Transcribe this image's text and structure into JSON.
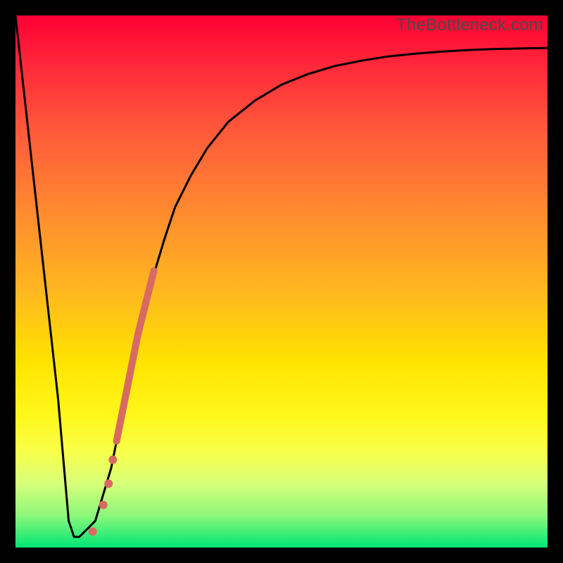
{
  "watermark": "TheBottleneck.com",
  "chart_data": {
    "type": "line",
    "title": "",
    "xlabel": "",
    "ylabel": "",
    "xlim": [
      0,
      100
    ],
    "ylim": [
      0,
      100
    ],
    "background_gradient": {
      "orientation": "vertical",
      "stops": [
        {
          "pos": 0.0,
          "color": "#ff0033"
        },
        {
          "pos": 0.22,
          "color": "#ff5a3a"
        },
        {
          "pos": 0.52,
          "color": "#ffb81f"
        },
        {
          "pos": 0.75,
          "color": "#fff71a"
        },
        {
          "pos": 0.94,
          "color": "#8cf77a"
        },
        {
          "pos": 1.0,
          "color": "#00e676"
        }
      ]
    },
    "series": [
      {
        "name": "bottleneck-curve",
        "stroke": "#000000",
        "stroke_width": 2,
        "x": [
          0,
          2,
          5,
          8,
          10,
          11,
          12,
          15,
          18,
          20,
          22,
          25,
          28,
          30,
          33,
          36,
          40,
          45,
          50,
          55,
          60,
          65,
          70,
          75,
          80,
          85,
          90,
          95,
          100
        ],
        "y": [
          100,
          82,
          55,
          28,
          5,
          2,
          2,
          5,
          15,
          25,
          35,
          48,
          58,
          64,
          70,
          75,
          80,
          84,
          87,
          89,
          90.5,
          91.5,
          92.3,
          92.8,
          93.2,
          93.5,
          93.7,
          93.8,
          93.9
        ]
      }
    ],
    "highlight_band": {
      "name": "highlighted-segment",
      "color": "#d86a62",
      "width": 10,
      "x": [
        19,
        20,
        21,
        22,
        23,
        24,
        25,
        26
      ],
      "y": [
        20,
        25,
        30,
        35,
        40,
        44,
        48,
        52
      ]
    },
    "markers": [
      {
        "x": 14.5,
        "y": 3,
        "r": 6,
        "color": "#d86a62"
      },
      {
        "x": 16.5,
        "y": 8,
        "r": 6,
        "color": "#d86a62"
      },
      {
        "x": 17.5,
        "y": 12,
        "r": 6,
        "color": "#d86a62"
      },
      {
        "x": 18.3,
        "y": 16.5,
        "r": 6,
        "color": "#d86a62"
      }
    ]
  }
}
